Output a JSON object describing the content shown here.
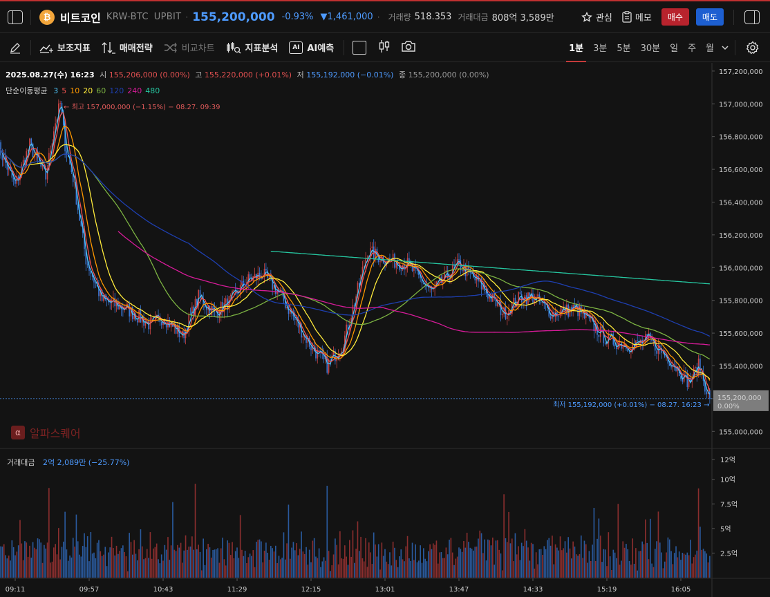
{
  "header": {
    "coin_icon": "bitcoin-icon",
    "coin_symbol": "₿",
    "coin_name": "비트코인",
    "pair": "KRW-BTC",
    "exchange": "UPBIT",
    "price": "155,200,000",
    "change_pct": "-0.93%",
    "change_amount": "▼1,461,000",
    "volume_label": "거래량",
    "volume_value": "518.353",
    "value_label": "거래대금",
    "value_value": "808억 3,589만",
    "favorite_label": "관심",
    "memo_label": "메모",
    "buy_label": "매수",
    "sell_label": "매도"
  },
  "toolbar": {
    "indicators": "보조지표",
    "strategy": "매매전략",
    "compare": "비교차트",
    "analysis": "지표분석",
    "ai_predict": "AI예측",
    "ai_badge": "AI",
    "timeframes": [
      "1분",
      "3분",
      "5분",
      "30분",
      "일",
      "주",
      "월"
    ],
    "active_timeframe": "1분"
  },
  "ohlc": {
    "date": "2025.08.27(수) 16:23",
    "open_label": "시",
    "open": "155,206,000 (0.00%)",
    "high_label": "고",
    "high": "155,220,000 (+0.01%)",
    "low_label": "저",
    "low": "155,192,000 (−0.01%)",
    "close_label": "종",
    "close": "155,200,000 (0.00%)"
  },
  "ma_legend": {
    "label": "단순이동평균",
    "items": [
      {
        "text": "3",
        "color": "#4fc3f7"
      },
      {
        "text": "5",
        "color": "#ef5350"
      },
      {
        "text": "10",
        "color": "#ff9800"
      },
      {
        "text": "20",
        "color": "#ffeb3b"
      },
      {
        "text": "60",
        "color": "#7cb342"
      },
      {
        "text": "120",
        "color": "#1e3fb0"
      },
      {
        "text": "240",
        "color": "#d81b9a"
      },
      {
        "text": "480",
        "color": "#26c6a0"
      }
    ]
  },
  "annotations": {
    "high_marker": "최고 157,000,000 (−1.15%) − 08.27. 09:39",
    "low_marker": "최저 155,192,000 (+0.01%) − 08.27. 16:23"
  },
  "watermark": "알파스퀘어",
  "volume_panel": {
    "label": "거래대금",
    "value": "2억 2,089만 (−25.77%)"
  },
  "colors": {
    "up": "#c94444",
    "down": "#3a78d8",
    "vol_up": "#8a2e2e",
    "vol_down": "#2a5a9e",
    "accent_blue": "#4e9bff"
  },
  "chart_data": [
    {
      "type": "candlestick",
      "title": "KRW-BTC 1분",
      "price_axis_ticks": [
        "157,200,000",
        "157,000,000",
        "156,800,000",
        "156,600,000",
        "156,400,000",
        "156,200,000",
        "156,000,000",
        "155,800,000",
        "155,600,000",
        "155,400,000",
        "155,200,000",
        "155,000,000"
      ],
      "ylim": [
        154900000,
        157250000
      ],
      "x_ticks": [
        "09:11",
        "09:57",
        "10:43",
        "11:29",
        "12:15",
        "13:01",
        "13:47",
        "14:33",
        "15:19",
        "16:05"
      ],
      "last_price_label": "155,200,000",
      "last_pct_label": "0.00%",
      "close_path": {
        "times": [
          "09:00",
          "09:11",
          "09:20",
          "09:30",
          "09:35",
          "09:39",
          "09:42",
          "09:47",
          "09:55",
          "10:05",
          "10:20",
          "10:35",
          "10:43",
          "10:55",
          "11:05",
          "11:15",
          "11:25",
          "11:35",
          "11:45",
          "11:55",
          "12:05",
          "12:15",
          "12:25",
          "12:35",
          "12:45",
          "12:50",
          "13:01",
          "13:15",
          "13:30",
          "13:47",
          "14:00",
          "14:15",
          "14:25",
          "14:33",
          "14:45",
          "15:00",
          "15:19",
          "15:35",
          "15:45",
          "16:00",
          "16:10",
          "16:16",
          "16:23"
        ],
        "values": [
          156750000,
          156500000,
          156750000,
          156550000,
          156850000,
          157000000,
          156750000,
          156550000,
          156050000,
          155800000,
          155750000,
          155650000,
          155700000,
          155580000,
          155820000,
          155720000,
          155800000,
          155920000,
          155960000,
          155850000,
          155680000,
          155520000,
          155400000,
          155540000,
          155900000,
          156100000,
          156050000,
          156020000,
          155850000,
          156020000,
          155900000,
          155720000,
          155820000,
          155820000,
          155720000,
          155750000,
          155560000,
          155520000,
          155560000,
          155420000,
          155300000,
          155400000,
          155200000
        ]
      },
      "ma_last_values": {
        "3": 155200000,
        "5": 155230000,
        "10": 155300000,
        "20": 155340000,
        "60": 155430000,
        "120": 155540000,
        "240": 155700000,
        "480": 155900000
      }
    },
    {
      "type": "bar",
      "title": "거래대금",
      "y_ticks": [
        "12억",
        "10억",
        "7.5억",
        "5억",
        "2.5억"
      ],
      "ylim": [
        0,
        1300000000
      ],
      "values_sample": [
        310000000,
        950000000,
        410000000,
        280000000,
        1250000000,
        360000000,
        220000000,
        520000000,
        300000000,
        700000000,
        180000000,
        420000000,
        590000000,
        220089000
      ]
    }
  ]
}
